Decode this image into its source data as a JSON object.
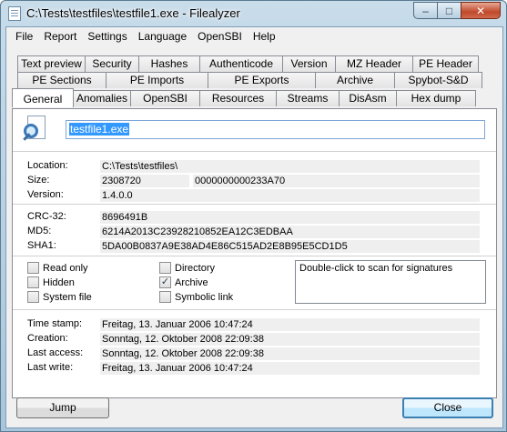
{
  "window": {
    "title": "C:\\Tests\\testfiles\\testfile1.exe - Filealyzer"
  },
  "menu": [
    "File",
    "Report",
    "Settings",
    "Language",
    "OpenSBI",
    "Help"
  ],
  "tabs": {
    "row1": [
      "Text preview",
      "Security",
      "Hashes",
      "Authenticode",
      "Version",
      "MZ Header",
      "PE Header"
    ],
    "row2": [
      "PE Sections",
      "PE Imports",
      "PE Exports",
      "Archive",
      "Spybot-S&D"
    ],
    "row3": [
      "General",
      "Anomalies",
      "OpenSBI",
      "Resources",
      "Streams",
      "DisAsm",
      "Hex dump"
    ]
  },
  "general": {
    "filename": "testfile1.exe",
    "location_label": "Location:",
    "location": "C:\\Tests\\testfiles\\",
    "size_label": "Size:",
    "size": "2308720",
    "size_hex": "0000000000233A70",
    "version_label": "Version:",
    "version": "1.4.0.0",
    "crc_label": "CRC-32:",
    "crc": "8696491B",
    "md5_label": "MD5:",
    "md5": "6214A2013C23928210852EA12C3EDBAA",
    "sha1_label": "SHA1:",
    "sha1": "5DA00B0837A9E38AD4E86C515AD2E8B95E5CD1D5",
    "attributes": {
      "read_only": {
        "label": "Read only",
        "checked": false
      },
      "hidden": {
        "label": "Hidden",
        "checked": false
      },
      "system_file": {
        "label": "System file",
        "checked": false
      },
      "directory": {
        "label": "Directory",
        "checked": false
      },
      "archive": {
        "label": "Archive",
        "checked": true
      },
      "symbolic_link": {
        "label": "Symbolic link",
        "checked": false
      }
    },
    "signature_hint": "Double-click to scan for signatures",
    "timestamp_label": "Time stamp:",
    "timestamp": "Freitag, 13. Januar 2006 10:47:24",
    "creation_label": "Creation:",
    "creation": "Sonntag, 12. Oktober 2008 22:09:38",
    "last_access_label": "Last access:",
    "last_access": "Sonntag, 12. Oktober 2008 22:09:38",
    "last_write_label": "Last write:",
    "last_write": "Freitag, 13. Januar 2006 10:47:24"
  },
  "buttons": {
    "jump": "Jump",
    "close": "Close"
  },
  "caption": {
    "minimize": "–",
    "maximize": "□",
    "close": "✕"
  }
}
